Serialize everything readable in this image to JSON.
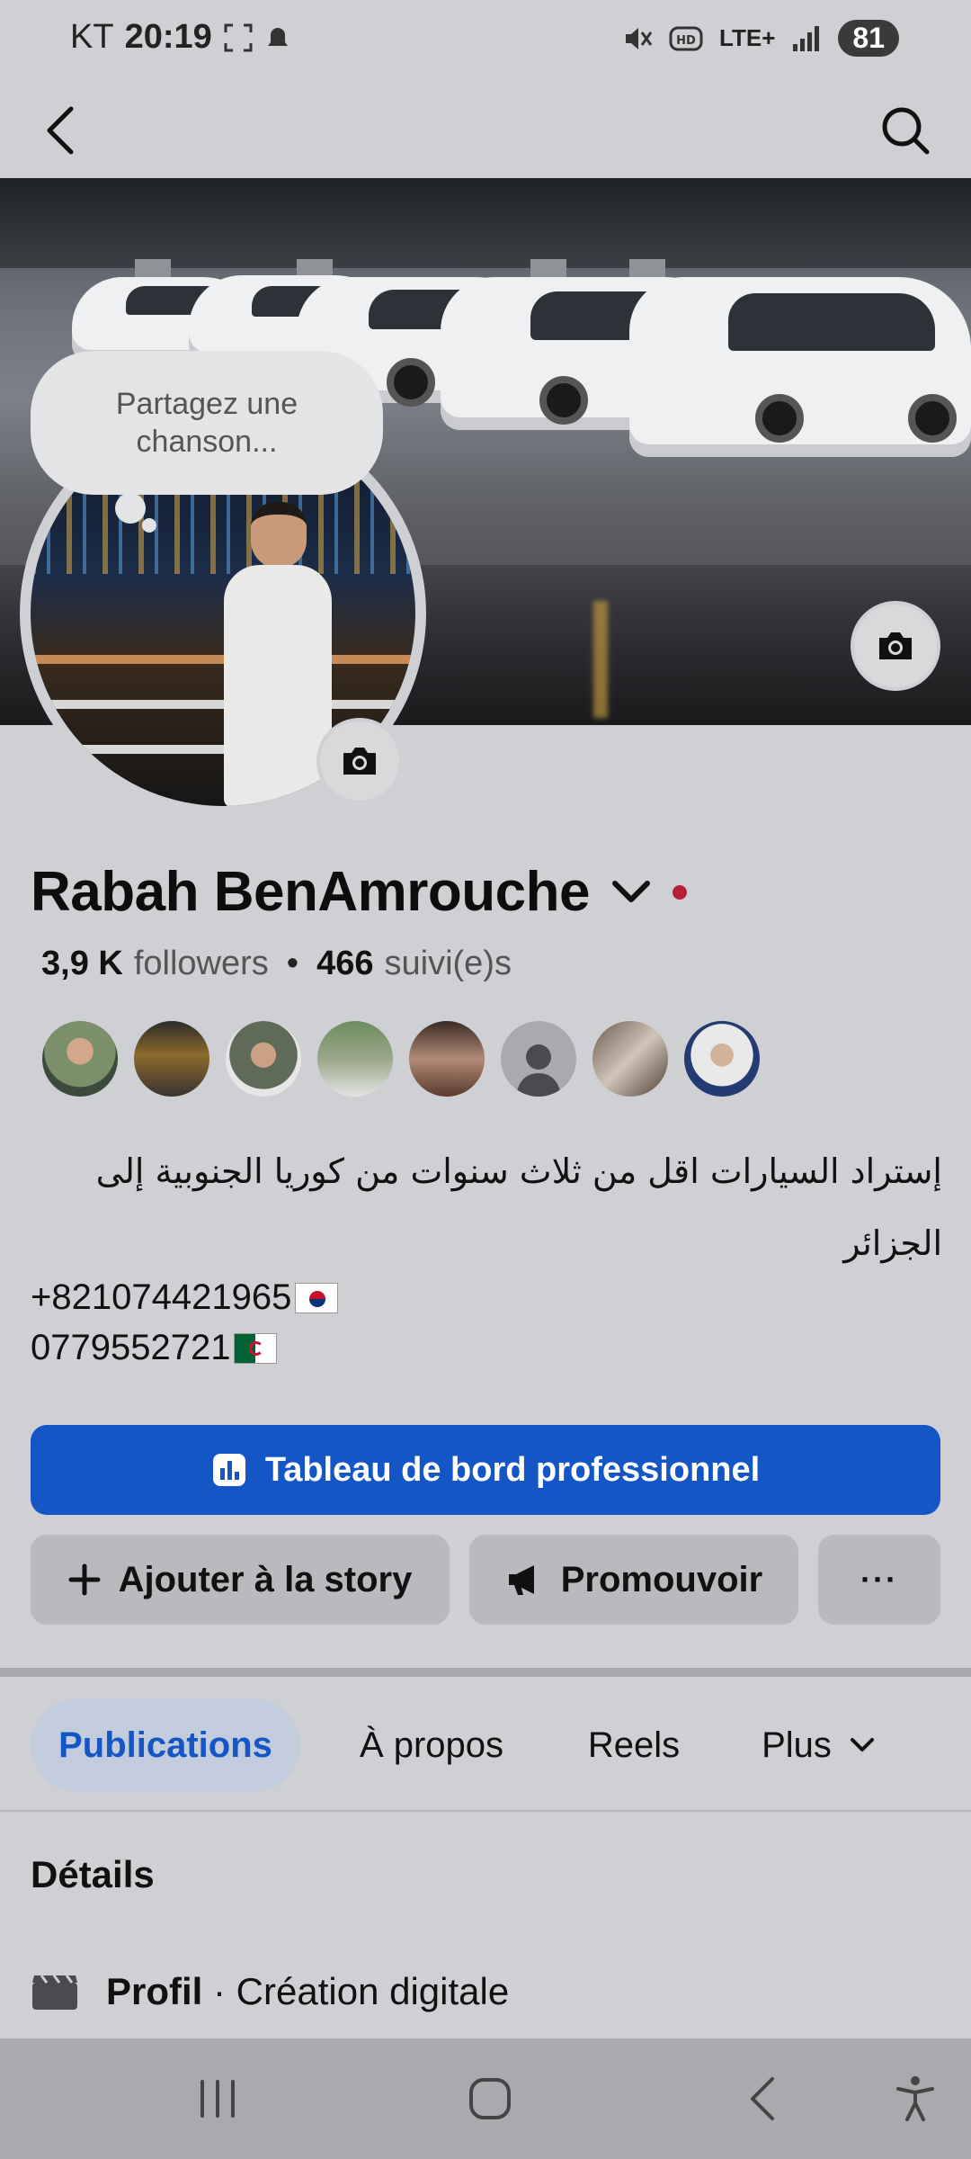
{
  "status_bar": {
    "carrier": "KT",
    "time": "20:19",
    "network": "LTE+",
    "battery": "81"
  },
  "profile": {
    "cover_prompt": "Partagez une chanson...",
    "name": "Rabah BenAmrouche",
    "followers_count": "3,9 K",
    "followers_label": "followers",
    "separator": "•",
    "following_count": "466",
    "following_label": "suivi(e)s",
    "bio": "إستراد السيارات اقل من ثلاث سنوات من كوريا الجنوبية إلى الجزائر",
    "phone_kr": "+821074421965",
    "phone_dz": "0779552721"
  },
  "actions": {
    "pro_dashboard": "Tableau de bord professionnel",
    "add_story": "Ajouter à la story",
    "promote": "Promouvoir",
    "more": "···"
  },
  "tabs": [
    {
      "label": "Publications",
      "active": true
    },
    {
      "label": "À propos",
      "active": false
    },
    {
      "label": "Reels",
      "active": false
    },
    {
      "label": "Plus",
      "active": false
    }
  ],
  "details": {
    "title": "Détails",
    "profile_label": "Profil",
    "profile_sep": " · ",
    "profile_category": "Création digitale"
  },
  "colors": {
    "accent_blue": "#1456c5",
    "background": "#cfd0d3",
    "active_dot": "#b51f3a"
  }
}
